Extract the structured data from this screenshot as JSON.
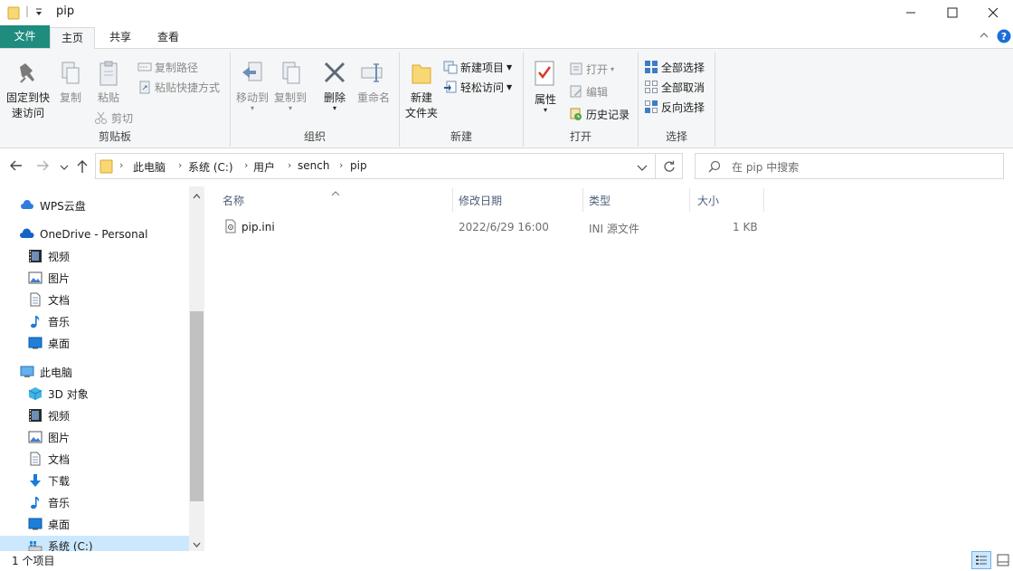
{
  "titlebar": {
    "title": "pip",
    "minimize": "—",
    "maximize": "☐",
    "close": "✕"
  },
  "tabs": {
    "file": "文件",
    "home": "主页",
    "share": "共享",
    "view": "查看"
  },
  "ribbon": {
    "clipboard": {
      "label": "剪贴板",
      "pin_line1": "固定到快",
      "pin_line2": "速访问",
      "copy": "复制",
      "paste": "粘贴",
      "copy_path": "复制路径",
      "paste_shortcut": "粘贴快捷方式",
      "cut": "剪切"
    },
    "organize": {
      "label": "组织",
      "move_to": "移动到",
      "copy_to": "复制到",
      "delete": "删除",
      "rename": "重命名"
    },
    "new": {
      "label": "新建",
      "new_folder_line1": "新建",
      "new_folder_line2": "文件夹",
      "new_item": "新建项目",
      "easy_access": "轻松访问"
    },
    "open": {
      "label": "打开",
      "properties": "属性",
      "open": "打开",
      "edit": "编辑",
      "history": "历史记录"
    },
    "select": {
      "label": "选择",
      "select_all": "全部选择",
      "select_none": "全部取消",
      "invert": "反向选择"
    }
  },
  "address": {
    "crumbs": [
      "此电脑",
      "系统 (C:)",
      "用户",
      "sench",
      "pip"
    ],
    "search_placeholder": "在 pip 中搜索"
  },
  "navpane": {
    "wps": "WPS云盘",
    "onedrive": "OneDrive - Personal",
    "od_videos": "视频",
    "od_pictures": "图片",
    "od_documents": "文档",
    "od_music": "音乐",
    "od_desktop": "桌面",
    "thispc": "此电脑",
    "pc_3d": "3D 对象",
    "pc_videos": "视频",
    "pc_pictures": "图片",
    "pc_documents": "文档",
    "pc_downloads": "下载",
    "pc_music": "音乐",
    "pc_desktop": "桌面",
    "pc_system": "系统 (C:)"
  },
  "filelist": {
    "columns": {
      "name": "名称",
      "modified": "修改日期",
      "type": "类型",
      "size": "大小"
    },
    "files": [
      {
        "name": "pip.ini",
        "modified": "2022/6/29 16:00",
        "type": "INI 源文件",
        "size": "1 KB"
      }
    ]
  },
  "status": {
    "count": "1 个项目"
  },
  "colors": {
    "file_tab": "#1e8c7e",
    "ribbon_bg": "#f5f6f7",
    "selected_nav": "#cce8ff",
    "column_header": "#4c607a"
  }
}
